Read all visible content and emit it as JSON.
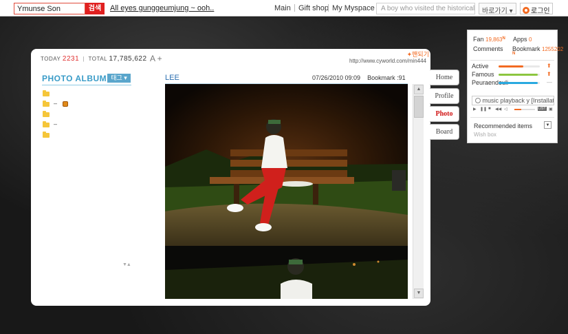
{
  "topbar": {
    "search_value": "Ymunse Son",
    "search_button": "검색",
    "marquee": "All eyes gunggeumjung ~ ooh..",
    "nav": [
      "Main",
      "Gift shop",
      "My Myspace"
    ],
    "ad_text": "A boy who visited the historical",
    "shortcut_label": "바로가기 ▾",
    "login_label": "로그인"
  },
  "frame": {
    "today_label": "TODAY",
    "today_count": "2231",
    "total_label": "TOTAL",
    "total_count": "17,785,622",
    "font_control": "A +",
    "fan_tag": "✦팬되기",
    "url": "http://www.cyworld.com/min444"
  },
  "album": {
    "title": "PHOTO ALBUM",
    "tag_button": "태그 ▾",
    "folders": [
      {
        "dash": ""
      },
      {
        "dash": "–"
      },
      {
        "dash": ""
      },
      {
        "dash": "–"
      },
      {
        "dash": ""
      }
    ],
    "scroll_arrows": "▼▲"
  },
  "post": {
    "author": "LEE",
    "date": "07/26/2010 09:09",
    "bookmark": "Bookmark :91"
  },
  "tabs": [
    "Home",
    "Profile",
    "Photo",
    "Board"
  ],
  "rpanel": {
    "fan_label": "Fan",
    "fan_value": "19,863",
    "apps_label": "Apps",
    "apps_value": "0",
    "comments_label": "Comments",
    "bookmark_label": "Bookmark",
    "bookmark_value": "1255202",
    "new_badge": "N",
    "stats": [
      {
        "label": "Active",
        "level": 0.6,
        "color": "#f26a21",
        "trend": "up"
      },
      {
        "label": "Famous",
        "level": 0.95,
        "color": "#8cc63f",
        "trend": "up"
      },
      {
        "label": "Peuraendeuli",
        "level": 0.95,
        "color": "#29a9e0",
        "trend": "flat"
      }
    ],
    "music": "music playback y [Installation]",
    "list_label": "LIST",
    "recommended": "Recommended items",
    "wishbox": "Wish box"
  },
  "colors": {
    "accent": "#f26a21",
    "brand_red": "#e02020",
    "album_blue": "#3a9cc8",
    "active_tab": "#d01010"
  }
}
